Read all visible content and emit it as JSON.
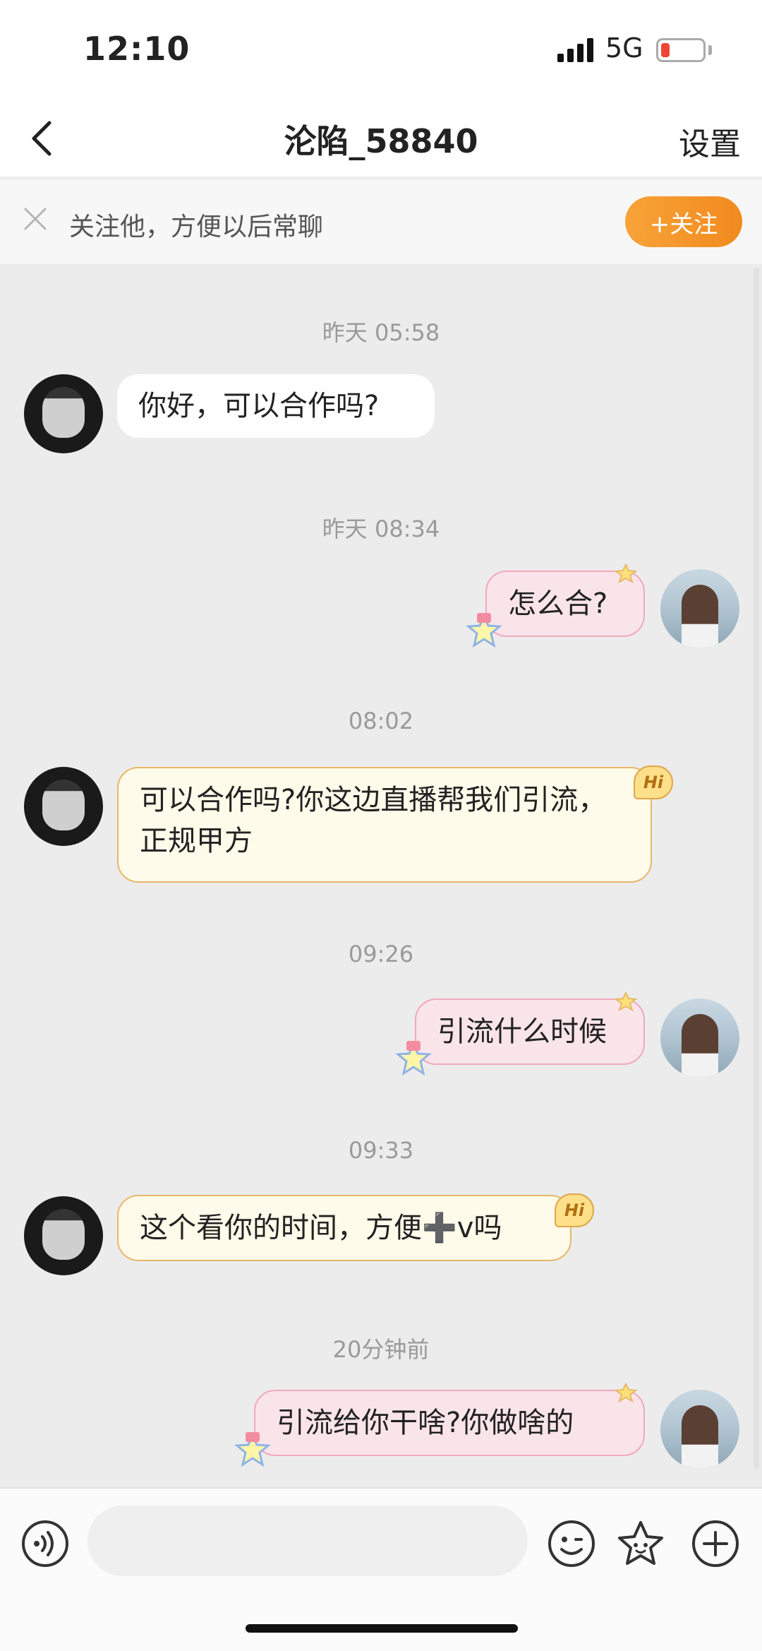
{
  "status_bar": {
    "time": "12:10",
    "network": "5G"
  },
  "nav": {
    "title": "沦陷_58840",
    "settings_label": "设置"
  },
  "follow_banner": {
    "text": "关注他，方便以后常聊",
    "button_label": "+关注"
  },
  "messages": [
    {
      "timestamp": "昨天 05:58",
      "side": "left",
      "text": "你好，可以合作吗?"
    },
    {
      "timestamp": "昨天 08:34",
      "side": "right",
      "text": "怎么合?"
    },
    {
      "timestamp": "08:02",
      "side": "left",
      "text": "可以合作吗?你这边直播帮我们引流，正规甲方"
    },
    {
      "timestamp": "09:26",
      "side": "right",
      "text": "引流什么时候"
    },
    {
      "timestamp": "09:33",
      "side": "left",
      "text": "这个看你的时间，方便➕v吗"
    },
    {
      "timestamp": "20分钟前",
      "side": "right",
      "text": "引流给你干啥?你做啥的"
    }
  ],
  "badge": {
    "hi": "Hi"
  },
  "input": {
    "placeholder": ""
  },
  "icons": [
    "back-icon",
    "close-icon",
    "voice-icon",
    "emoji-icon",
    "star-sticker-icon",
    "plus-icon",
    "signal-icon",
    "battery-icon"
  ],
  "colors": {
    "accent": "#f28a1e",
    "pink_bubble": "#f9e4ea",
    "cream_bubble": "#fffbea",
    "battery_low": "#ef4535"
  }
}
